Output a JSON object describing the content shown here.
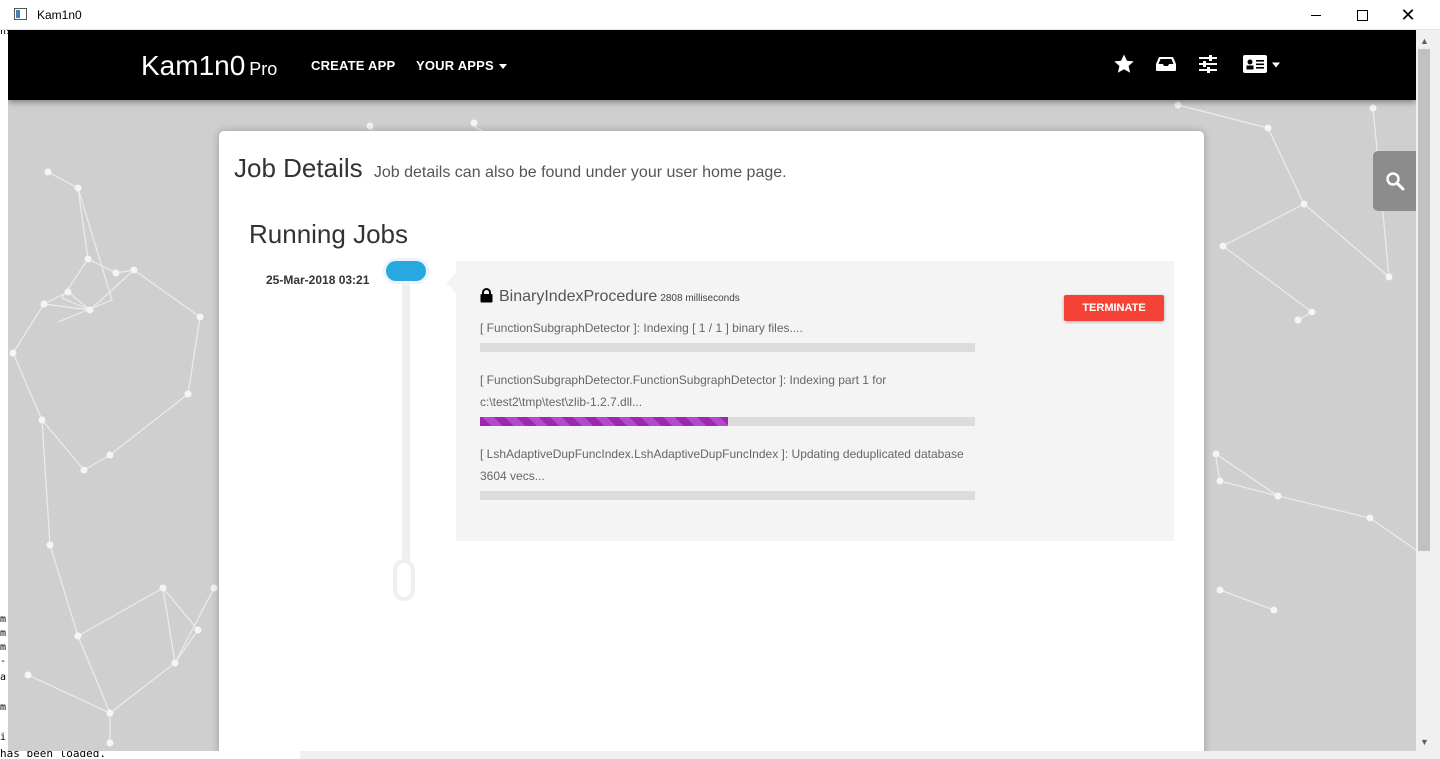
{
  "window": {
    "title": "Kam1n0",
    "min_label": "—",
    "max_label": "□",
    "close_label": "✕"
  },
  "console": {
    "bottom_text": "has been loaded."
  },
  "navbar": {
    "brand": "Kam1n0",
    "brand_sub": "Pro",
    "create_app": "CREATE APP",
    "your_apps": "YOUR APPS",
    "icons": [
      "star-icon",
      "inbox-icon",
      "sliders-icon",
      "id-card-icon"
    ]
  },
  "page": {
    "title": "Job Details",
    "subtitle": "Job details can also be found under your user home page.",
    "section_title": "Running Jobs"
  },
  "job": {
    "date": "25-Mar-2018 03:21",
    "name": "BinaryIndexProcedure",
    "duration": "2808 milliseconds",
    "terminate_label": "TERMINATE",
    "tasks": [
      {
        "line1": "[ FunctionSubgraphDetector ]: Indexing [ 1 / 1 ] binary files....",
        "line2": "",
        "progress": 0
      },
      {
        "line1": "[ FunctionSubgraphDetector.FunctionSubgraphDetector ]: Indexing part 1 for",
        "line2": "c:\\test2\\tmp\\test\\zlib-1.2.7.dll...",
        "progress": 0.5
      },
      {
        "line1": "[ LshAdaptiveDupFuncIndex.LshAdaptiveDupFuncIndex ]: Updating deduplicated database",
        "line2": "3604 vecs...",
        "progress": 0
      }
    ]
  },
  "colors": {
    "navbar_bg": "#000000",
    "timeline_accent": "#29a8e0",
    "terminate": "#f44336",
    "progress_fill": "#9c27b0"
  }
}
